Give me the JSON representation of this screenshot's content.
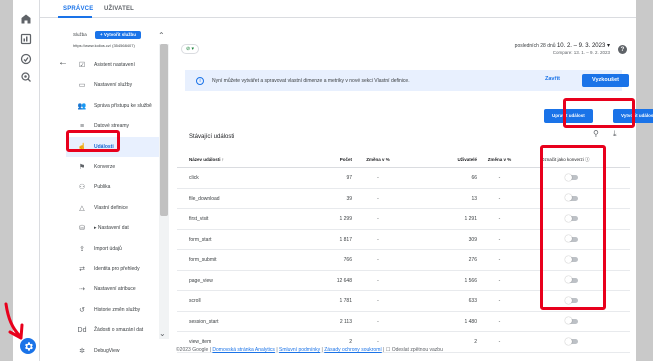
{
  "colors": {
    "accent": "#1a73e8",
    "annotation": "#e8001c"
  },
  "rail": {
    "icons": [
      "home-icon",
      "reports-icon",
      "explore-icon",
      "advertising-icon"
    ],
    "settings_icon": "gear-icon"
  },
  "tabs": {
    "admin": "SPRÁVCE",
    "user": "UŽIVATEL"
  },
  "service": {
    "label": "Služba",
    "create_button": "+ Vytvořit službu",
    "url": "https://www.kolios.cz/ (354568407)"
  },
  "sidebar": {
    "items": [
      {
        "label": "Asistent nastavení",
        "icon": "checklist-icon",
        "active": false
      },
      {
        "label": "Nastavení služby",
        "icon": "property-icon",
        "active": false
      },
      {
        "label": "Správa přístupu ke službě",
        "icon": "people-icon",
        "active": false
      },
      {
        "label": "Datové streamy",
        "icon": "streams-icon",
        "active": false
      },
      {
        "label": "Události",
        "icon": "events-icon",
        "active": true
      },
      {
        "label": "Konverze",
        "icon": "flag-icon",
        "active": false
      },
      {
        "label": "Publika",
        "icon": "audience-icon",
        "active": false
      },
      {
        "label": "Vlastní definice",
        "icon": "shapes-icon",
        "active": false
      },
      {
        "label": "▸ Nastavení dat",
        "icon": "database-icon",
        "active": false
      },
      {
        "label": "Import údajů",
        "icon": "upload-icon",
        "active": false
      },
      {
        "label": "Identita pro přehledy",
        "icon": "identity-icon",
        "active": false
      },
      {
        "label": "Nastavení atribuce",
        "icon": "attribution-icon",
        "active": false
      },
      {
        "label": "Historie změn služby",
        "icon": "history-icon",
        "active": false
      },
      {
        "label": "Žádosti o smazání dat",
        "icon": "dd-icon",
        "active": false
      },
      {
        "label": "DebugView",
        "icon": "debug-icon",
        "active": false
      }
    ]
  },
  "header": {
    "status": "⊘ ▾",
    "range_prefix": "posledních 28 dnů",
    "range_value": "10. 2. – 9. 3. 2023 ▾",
    "compare": "Compare: 13. 1. – 9. 2. 2023"
  },
  "banner": {
    "text": "Nyní můžete vytvářet a spravovat vlastní dimenze a metriky v nové sekci Vlastní definice.",
    "dismiss": "Zavřít",
    "cta": "Vyzkoušet"
  },
  "actions": {
    "edit": "Upravit událost",
    "create": "Vytvořit událost"
  },
  "table": {
    "title": "Stávající události",
    "headers": {
      "name": "Název události ↑",
      "count": "Počet",
      "count_change": "Změna v %",
      "users": "Uživatelé",
      "users_change": "Změna v %",
      "conversion": "Označit jako konverzi ⓘ"
    },
    "rows": [
      {
        "name": "click",
        "count": "97",
        "count_change": "-",
        "users": "66",
        "users_change": "-",
        "conversion": false
      },
      {
        "name": "file_download",
        "count": "39",
        "count_change": "-",
        "users": "13",
        "users_change": "-",
        "conversion": false
      },
      {
        "name": "first_visit",
        "count": "1 299",
        "count_change": "-",
        "users": "1 291",
        "users_change": "-",
        "conversion": false
      },
      {
        "name": "form_start",
        "count": "1 817",
        "count_change": "-",
        "users": "309",
        "users_change": "-",
        "conversion": false
      },
      {
        "name": "form_submit",
        "count": "766",
        "count_change": "-",
        "users": "276",
        "users_change": "-",
        "conversion": false
      },
      {
        "name": "page_view",
        "count": "12 648",
        "count_change": "-",
        "users": "1 566",
        "users_change": "-",
        "conversion": false
      },
      {
        "name": "scroll",
        "count": "1 781",
        "count_change": "-",
        "users": "633",
        "users_change": "-",
        "conversion": false
      },
      {
        "name": "session_start",
        "count": "2 113",
        "count_change": "-",
        "users": "1 480",
        "users_change": "-",
        "conversion": false
      },
      {
        "name": "view_item",
        "count": "2",
        "count_change": "-",
        "users": "2",
        "users_change": "-",
        "conversion": false
      }
    ]
  },
  "footer": {
    "copyright": "©2023 Google |",
    "link1": "Domovská stránka Analytics",
    "link2": "Smluvní podmínky",
    "link3": "Zásady ochrony soukromí",
    "feedback": "| ☐ Odeslat zpětnou vazbu"
  }
}
